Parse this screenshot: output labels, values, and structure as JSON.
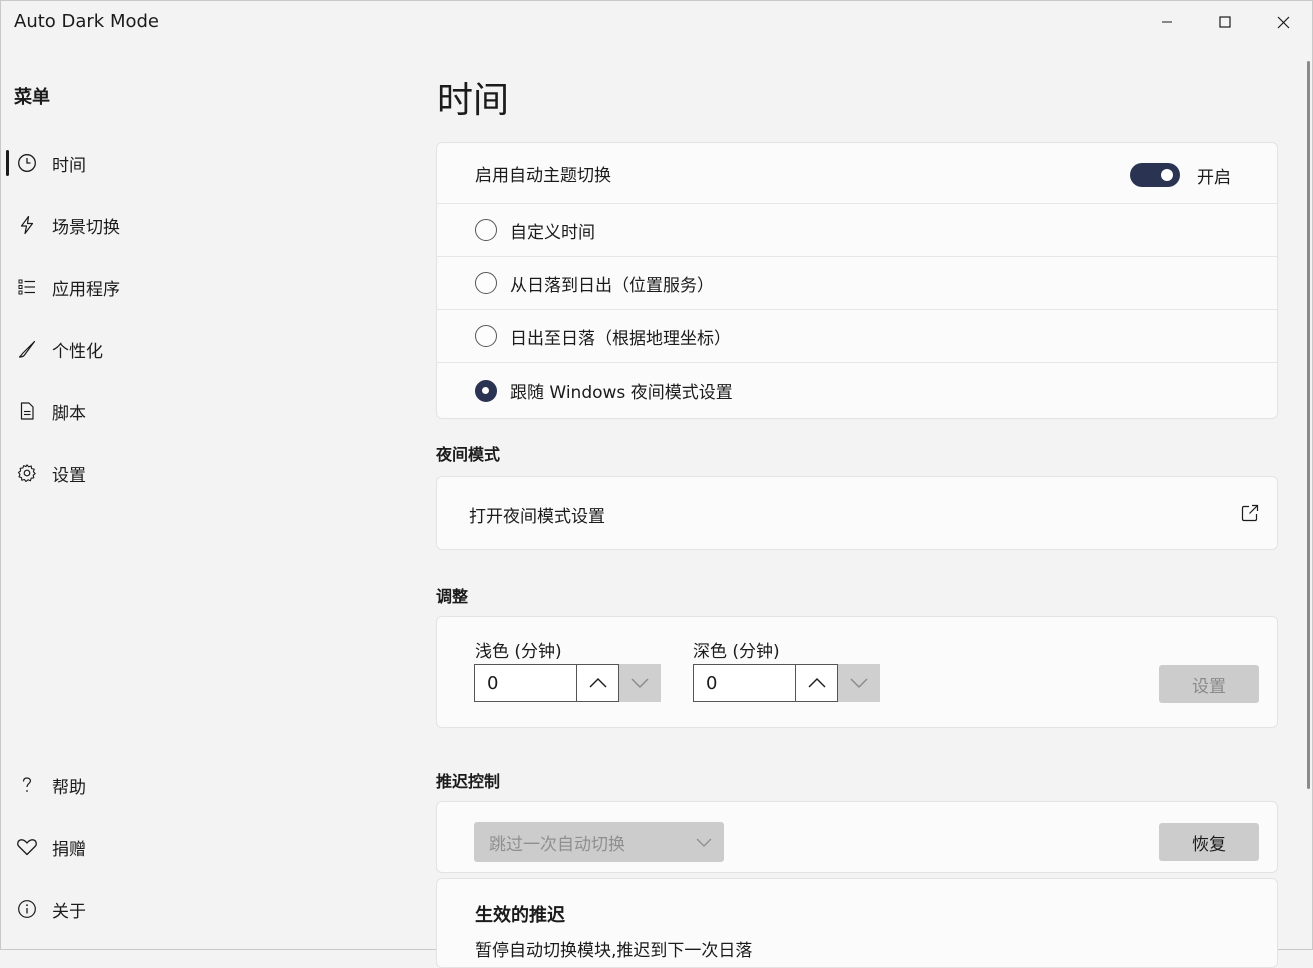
{
  "window": {
    "title": "Auto Dark Mode",
    "controls": [
      "minimize-icon",
      "maximize-icon",
      "close-icon"
    ]
  },
  "sidebar": {
    "menu_title": "菜单",
    "items": [
      {
        "label": "时间",
        "icon": "clock-icon",
        "active": true
      },
      {
        "label": "场景切换",
        "icon": "lightning-icon"
      },
      {
        "label": "应用程序",
        "icon": "list-icon"
      },
      {
        "label": "个性化",
        "icon": "brush-icon"
      },
      {
        "label": "脚本",
        "icon": "document-icon"
      },
      {
        "label": "设置",
        "icon": "gear-icon"
      }
    ],
    "footer_items": [
      {
        "label": "帮助",
        "icon": "question-icon"
      },
      {
        "label": "捐赠",
        "icon": "heart-icon"
      },
      {
        "label": "关于",
        "icon": "info-icon"
      }
    ]
  },
  "main": {
    "page_title": "时间",
    "auto_switch": {
      "label": "启用自动主题切换",
      "toggle_state": "开启",
      "enabled": true
    },
    "modes": [
      {
        "label": "自定义时间",
        "checked": false
      },
      {
        "label": "从日落到日出（位置服务）",
        "checked": false
      },
      {
        "label": "日出至日落（根据地理坐标）",
        "checked": false
      },
      {
        "label": "跟随 Windows 夜间模式设置",
        "checked": true
      }
    ],
    "night_mode": {
      "heading": "夜间模式",
      "link_label": "打开夜间模式设置",
      "icon": "external-link-icon"
    },
    "adjust": {
      "heading": "调整",
      "light_label": "浅色 (分钟)",
      "light_value": "0",
      "dark_label": "深色 (分钟)",
      "dark_value": "0",
      "set_button": "设置"
    },
    "postpone": {
      "heading": "推迟控制",
      "dropdown_value": "跳过一次自动切换",
      "restore_button": "恢复",
      "active_title": "生效的推迟",
      "active_desc": "暂停自动切换模块,推迟到下一次日落"
    }
  }
}
